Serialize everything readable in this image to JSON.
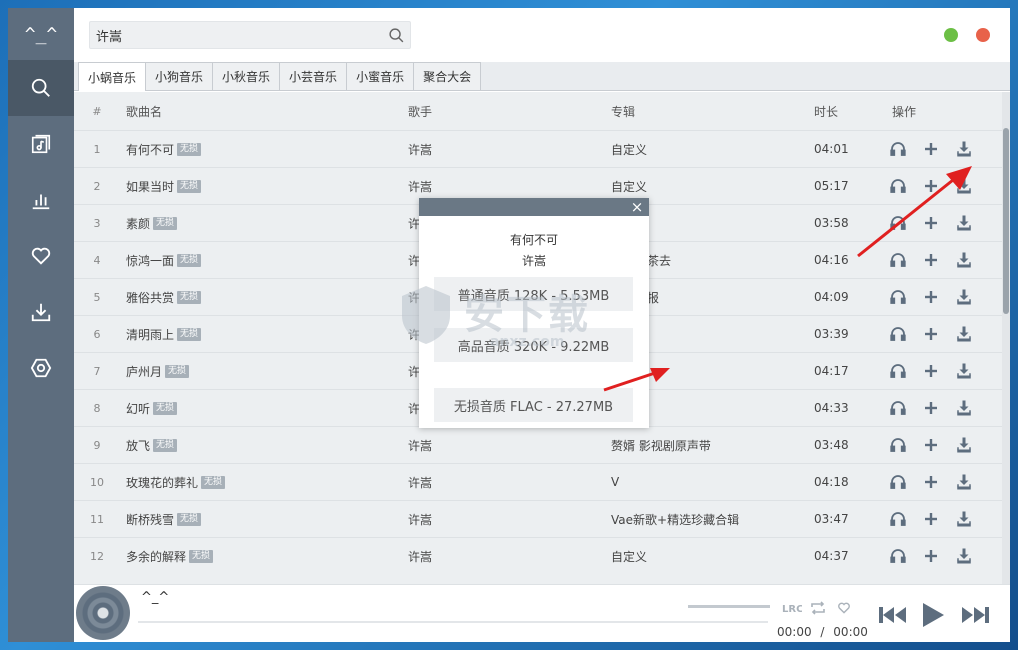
{
  "app": {
    "logo": "^_^",
    "search": {
      "value": "许嵩",
      "placeholder": ""
    }
  },
  "sidebar": {
    "items": [
      {
        "name": "search",
        "icon": "search-icon",
        "active": true
      },
      {
        "name": "playlist",
        "icon": "music-file-icon",
        "active": false
      },
      {
        "name": "charts",
        "icon": "bar-chart-icon",
        "active": false
      },
      {
        "name": "favorites",
        "icon": "heart-icon",
        "active": false
      },
      {
        "name": "downloads",
        "icon": "download-icon",
        "active": false
      },
      {
        "name": "settings",
        "icon": "hexagon-settings-icon",
        "active": false
      }
    ]
  },
  "window_controls": {
    "minimize_color": "#6cbf45",
    "close_color": "#e8624a"
  },
  "tabs": [
    {
      "label": "小蜗音乐",
      "active": true
    },
    {
      "label": "小狗音乐",
      "active": false
    },
    {
      "label": "小秋音乐",
      "active": false
    },
    {
      "label": "小芸音乐",
      "active": false
    },
    {
      "label": "小蜜音乐",
      "active": false
    },
    {
      "label": "聚合大会",
      "active": false
    }
  ],
  "table": {
    "headers": {
      "num": "#",
      "name": "歌曲名",
      "artist": "歌手",
      "album": "专辑",
      "duration": "时长",
      "ops": "操作"
    },
    "badge": "无损",
    "rows": [
      {
        "num": "1",
        "name": "有何不可",
        "artist": "许嵩",
        "album": "自定义",
        "duration": "04:01"
      },
      {
        "num": "2",
        "name": "如果当时",
        "artist": "许嵩",
        "album": "自定义",
        "duration": "05:17"
      },
      {
        "num": "3",
        "name": "素颜",
        "artist": "许嵩",
        "album": "",
        "duration": "03:58"
      },
      {
        "num": "4",
        "name": "惊鸿一面",
        "artist": "许嵩",
        "album": "不如吃茶去",
        "duration": "04:16"
      },
      {
        "num": "5",
        "name": "雅俗共赏",
        "artist": "许嵩",
        "album": "青年晚报",
        "duration": "04:09"
      },
      {
        "num": "6",
        "name": "清明雨上",
        "artist": "许嵩",
        "album": "",
        "duration": "03:39"
      },
      {
        "num": "7",
        "name": "庐州月",
        "artist": "许嵩",
        "album": "",
        "duration": "04:17"
      },
      {
        "num": "8",
        "name": "幻听",
        "artist": "许嵩",
        "album": "",
        "duration": "04:33"
      },
      {
        "num": "9",
        "name": "放飞",
        "artist": "许嵩",
        "album": "赘婿 影视剧原声带",
        "duration": "03:48"
      },
      {
        "num": "10",
        "name": "玫瑰花的葬礼",
        "artist": "许嵩",
        "album": "V",
        "duration": "04:18"
      },
      {
        "num": "11",
        "name": "断桥残雪",
        "artist": "许嵩",
        "album": "Vae新歌+精选珍藏合辑",
        "duration": "03:47"
      },
      {
        "num": "12",
        "name": "多余的解释",
        "artist": "许嵩",
        "album": "自定义",
        "duration": "04:37"
      }
    ]
  },
  "modal": {
    "song": "有何不可",
    "artist": "许嵩",
    "close": "×",
    "options": [
      "普通音质 128K - 5.53MB",
      "高品音质 320K - 9.22MB",
      "无损音质 FLAC - 27.27MB"
    ]
  },
  "watermark": {
    "main": "安下载",
    "sub": "anxz.com"
  },
  "player": {
    "title": "^_^",
    "current_time": "00:00",
    "separator": "/",
    "total_time": "00:00",
    "progress": 0
  }
}
